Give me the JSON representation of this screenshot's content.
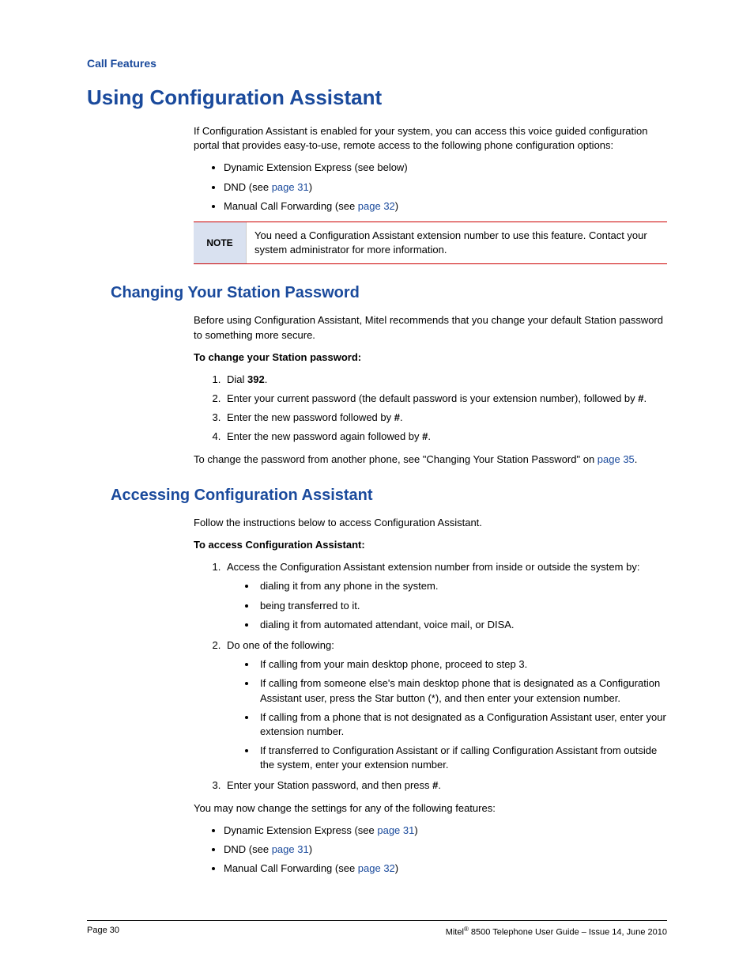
{
  "header": {
    "section": "Call Features"
  },
  "h1": "Using Configuration Assistant",
  "intro": "If Configuration Assistant is enabled for your system, you can access this voice guided configuration portal that provides easy-to-use, remote access to the following phone configuration options:",
  "introList": {
    "i1a": "Dynamic Extension Express (see below)",
    "i2a": "DND (see ",
    "i2link": "page 31",
    "i2b": ")",
    "i3a": "Manual Call Forwarding (see ",
    "i3link": "page 32",
    "i3b": ")"
  },
  "note": {
    "label": "NOTE",
    "text": "You need a Configuration Assistant extension number to use this feature. Contact your system administrator for more information."
  },
  "h2a": "Changing Your Station Password",
  "changePwd": {
    "intro": "Before using Configuration Assistant, Mitel recommends that you change your default Station password to something more secure.",
    "instrHead": "To change your Station password:",
    "s1a": "Dial ",
    "s1b": "392",
    "s1c": ".",
    "s2a": "Enter your current password (the default password is your extension number), followed by ",
    "s2b": "#",
    "s2c": ".",
    "s3a": "Enter the new password followed by ",
    "s3b": "#",
    "s3c": ".",
    "s4a": "Enter the new password again followed by ",
    "s4b": "#",
    "s4c": ".",
    "outroA": "To change the password from another phone, see \"Changing Your Station Password\" on ",
    "outroLink": "page 35",
    "outroB": "."
  },
  "h2b": "Accessing Configuration Assistant",
  "access": {
    "intro": "Follow the instructions below to access Configuration Assistant.",
    "instrHead": "To access Configuration Assistant:",
    "s1": "Access the Configuration Assistant extension number from inside or outside the system by:",
    "s1sub1": "dialing it from any phone in the system.",
    "s1sub2": "being transferred to it.",
    "s1sub3": "dialing it from automated attendant, voice mail, or DISA.",
    "s2": "Do one of the following:",
    "s2sub1": "If calling from your main desktop phone, proceed to step 3.",
    "s2sub2": "If calling from someone else's main desktop phone that is designated as a Configuration Assistant user, press the Star button (*), and then enter your extension number.",
    "s2sub3": "If calling from a phone that is not designated as a Configuration Assistant user, enter your extension number.",
    "s2sub4": "If transferred to Configuration Assistant or if calling Configuration Assistant from outside the system, enter your extension number.",
    "s3a": "Enter your Station password, and then press ",
    "s3b": "#",
    "s3c": ".",
    "outro": "You may now change the settings for any of the following features:",
    "f1a": "Dynamic Extension Express (see ",
    "f1link": "page 31",
    "f1b": ")",
    "f2a": "DND (see ",
    "f2link": "page 31",
    "f2b": ")",
    "f3a": "Manual Call Forwarding (see ",
    "f3link": "page 32",
    "f3b": ")"
  },
  "footer": {
    "left": "Page 30",
    "rightA": "Mitel",
    "rightSup": "®",
    "rightB": " 8500 Telephone User Guide – Issue 14, June 2010"
  }
}
